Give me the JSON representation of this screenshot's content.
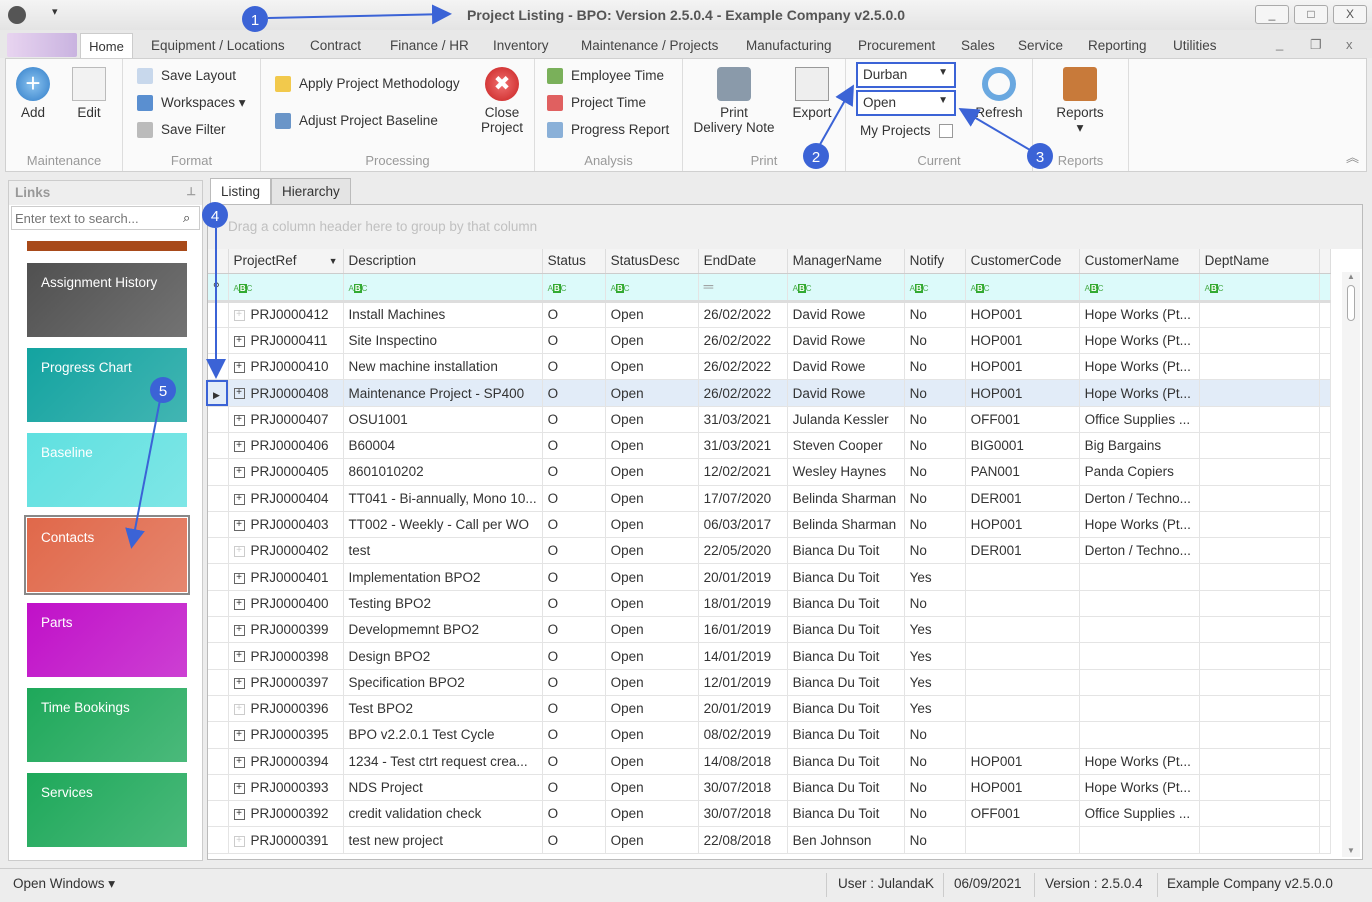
{
  "window": {
    "title": "Project Listing - BPO: Version 2.5.0.4 - Example Company v2.5.0.0",
    "minimize": "_",
    "maximize": "□",
    "close": "X"
  },
  "menu_tabs": [
    "Home",
    "Equipment / Locations",
    "Contract",
    "Finance / HR",
    "Inventory",
    "Maintenance / Projects",
    "Manufacturing",
    "Procurement",
    "Sales",
    "Service",
    "Reporting",
    "Utilities"
  ],
  "ribbon": {
    "maintenance": {
      "label": "Maintenance",
      "add": "Add",
      "edit": "Edit"
    },
    "format": {
      "label": "Format",
      "save_layout": "Save Layout",
      "workspaces": "Workspaces ▾",
      "save_filter": "Save Filter"
    },
    "processing": {
      "label": "Processing",
      "apply": "Apply Project Methodology",
      "adjust": "Adjust Project Baseline",
      "close1": "Close",
      "close2": "Project"
    },
    "analysis": {
      "label": "Analysis",
      "employee_time": "Employee Time",
      "project_time": "Project Time",
      "progress_report": "Progress Report"
    },
    "print": {
      "label": "Print",
      "print1": "Print",
      "print2": "Delivery Note",
      "export": "Export"
    },
    "current": {
      "label": "Current",
      "location": "Durban",
      "status": "Open",
      "my_projects": "My Projects",
      "refresh": "Refresh"
    },
    "reports": {
      "label": "Reports",
      "reports": "Reports"
    }
  },
  "links": {
    "title": "Links",
    "search_placeholder": "Enter text to search...",
    "tiles": [
      {
        "label": "Assignment History",
        "color": "#505050"
      },
      {
        "label": "Progress Chart",
        "color": "#13a3a0"
      },
      {
        "label": "Baseline",
        "color": "#5fe0e0"
      },
      {
        "label": "Contacts",
        "color": "#e0684a"
      },
      {
        "label": "Parts",
        "color": "#c010c8"
      },
      {
        "label": "Time Bookings",
        "color": "#1ea85a"
      },
      {
        "label": "Services",
        "color": "#1ea85a"
      }
    ]
  },
  "content_tabs": [
    "Listing",
    "Hierarchy"
  ],
  "grid": {
    "group_hint": "Drag a column header here to group by that column",
    "columns": [
      "ProjectRef",
      "Description",
      "Status",
      "StatusDesc",
      "EndDate",
      "ManagerName",
      "Notify",
      "CustomerCode",
      "CustomerName",
      "DeptName"
    ],
    "selected_ref": "PRJ0000408",
    "rows": [
      [
        "PRJ0000412",
        "Install Machines",
        "O",
        "Open",
        "26/02/2022",
        "David Rowe",
        "No",
        "HOP001",
        "Hope Works (Pt...",
        ""
      ],
      [
        "PRJ0000411",
        "Site Inspectino",
        "O",
        "Open",
        "26/02/2022",
        "David Rowe",
        "No",
        "HOP001",
        "Hope Works (Pt...",
        ""
      ],
      [
        "PRJ0000410",
        "New machine installation",
        "O",
        "Open",
        "26/02/2022",
        "David Rowe",
        "No",
        "HOP001",
        "Hope Works (Pt...",
        ""
      ],
      [
        "PRJ0000408",
        "Maintenance Project - SP400",
        "O",
        "Open",
        "26/02/2022",
        "David Rowe",
        "No",
        "HOP001",
        "Hope Works (Pt...",
        ""
      ],
      [
        "PRJ0000407",
        "OSU1001",
        "O",
        "Open",
        "31/03/2021",
        "Julanda Kessler",
        "No",
        "OFF001",
        "Office Supplies ...",
        ""
      ],
      [
        "PRJ0000406",
        "B60004",
        "O",
        "Open",
        "31/03/2021",
        "Steven Cooper",
        "No",
        "BIG0001",
        "Big Bargains",
        ""
      ],
      [
        "PRJ0000405",
        "8601010202",
        "O",
        "Open",
        "12/02/2021",
        "Wesley Haynes",
        "No",
        "PAN001",
        "Panda Copiers",
        ""
      ],
      [
        "PRJ0000404",
        "TT041 - Bi-annually, Mono 10...",
        "O",
        "Open",
        "17/07/2020",
        "Belinda Sharman",
        "No",
        "DER001",
        "Derton / Techno...",
        ""
      ],
      [
        "PRJ0000403",
        "TT002 - Weekly - Call per WO",
        "O",
        "Open",
        "06/03/2017",
        "Belinda Sharman",
        "No",
        "HOP001",
        "Hope Works (Pt...",
        ""
      ],
      [
        "PRJ0000402",
        "test",
        "O",
        "Open",
        "22/05/2020",
        "Bianca Du Toit",
        "No",
        "DER001",
        "Derton / Techno...",
        ""
      ],
      [
        "PRJ0000401",
        "Implementation BPO2",
        "O",
        "Open",
        "20/01/2019",
        "Bianca Du Toit",
        "Yes",
        "",
        "",
        ""
      ],
      [
        "PRJ0000400",
        "Testing BPO2",
        "O",
        "Open",
        "18/01/2019",
        "Bianca Du Toit",
        "No",
        "",
        "",
        ""
      ],
      [
        "PRJ0000399",
        "Developmemnt BPO2",
        "O",
        "Open",
        "16/01/2019",
        "Bianca Du Toit",
        "Yes",
        "",
        "",
        ""
      ],
      [
        "PRJ0000398",
        "Design BPO2",
        "O",
        "Open",
        "14/01/2019",
        "Bianca Du Toit",
        "Yes",
        "",
        "",
        ""
      ],
      [
        "PRJ0000397",
        "Specification BPO2",
        "O",
        "Open",
        "12/01/2019",
        "Bianca Du Toit",
        "Yes",
        "",
        "",
        ""
      ],
      [
        "PRJ0000396",
        "Test BPO2",
        "O",
        "Open",
        "20/01/2019",
        "Bianca Du Toit",
        "Yes",
        "",
        "",
        ""
      ],
      [
        "PRJ0000395",
        "BPO v2.2.0.1 Test Cycle",
        "O",
        "Open",
        "08/02/2019",
        "Bianca Du Toit",
        "No",
        "",
        "",
        ""
      ],
      [
        "PRJ0000394",
        "1234 - Test ctrt request crea...",
        "O",
        "Open",
        "14/08/2018",
        "Bianca Du Toit",
        "No",
        "HOP001",
        "Hope Works (Pt...",
        ""
      ],
      [
        "PRJ0000393",
        "NDS Project",
        "O",
        "Open",
        "30/07/2018",
        "Bianca Du Toit",
        "No",
        "HOP001",
        "Hope Works (Pt...",
        ""
      ],
      [
        "PRJ0000392",
        "credit validation check",
        "O",
        "Open",
        "30/07/2018",
        "Bianca Du Toit",
        "No",
        "OFF001",
        "Office Supplies ...",
        ""
      ],
      [
        "PRJ0000391",
        "test new project",
        "O",
        "Open",
        "22/08/2018",
        "Ben Johnson",
        "No",
        "",
        "",
        ""
      ]
    ]
  },
  "statusbar": {
    "open_windows": "Open Windows ▾",
    "user": "User : JulandaK",
    "date": "06/09/2021",
    "version": "Version : 2.5.0.4",
    "company": "Example Company v2.5.0.0"
  },
  "annotations": [
    "1",
    "2",
    "3",
    "4",
    "5"
  ],
  "accent": "#3b63d6"
}
